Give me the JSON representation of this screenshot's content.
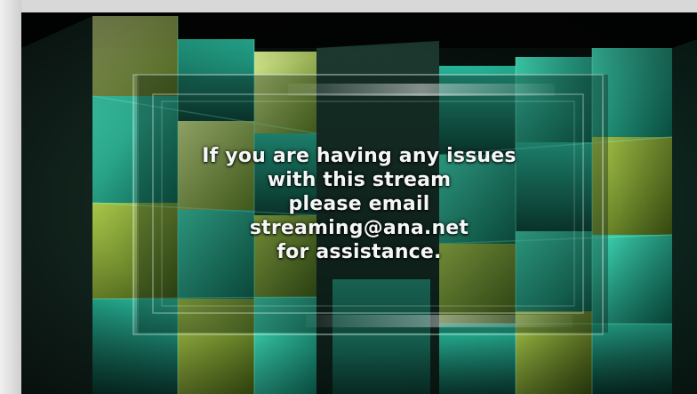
{
  "message": {
    "line1": "If you are having any issues",
    "line2": "with this stream",
    "line3": "please email",
    "line4": "streaming@ana.net",
    "line5": "for assistance."
  },
  "colors": {
    "accent_teal": "#1fa88f",
    "accent_lime": "#9acb3a",
    "background": "#050807",
    "text": "#f4f7f5"
  }
}
